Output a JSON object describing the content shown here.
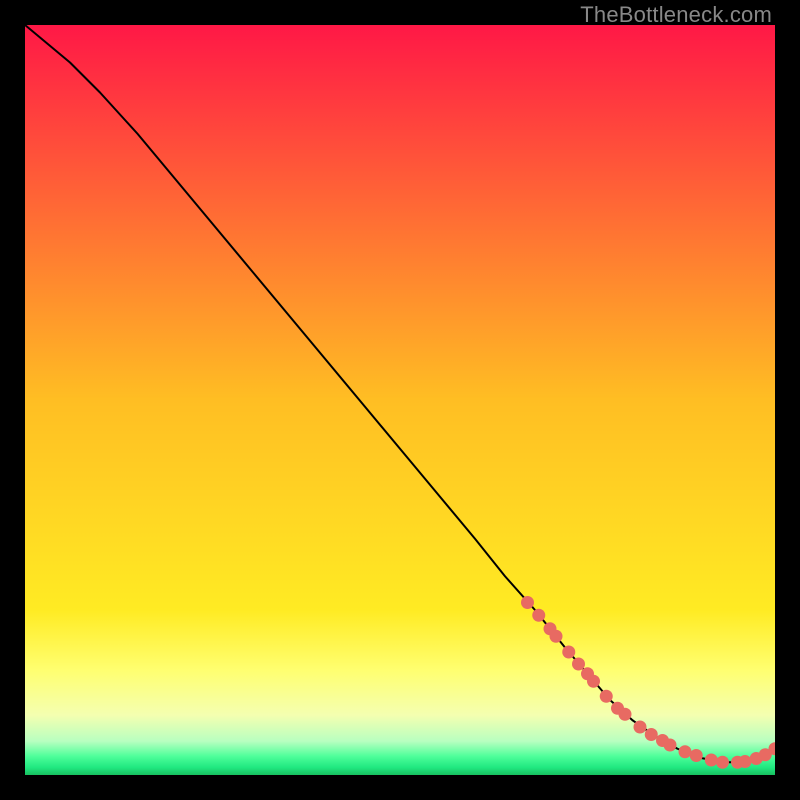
{
  "watermark": "TheBottleneck.com",
  "colors": {
    "background": "#000000",
    "curve": "#000000",
    "marker": "#e86a62",
    "gradient_stops": [
      {
        "offset": 0.0,
        "color": "#ff1846"
      },
      {
        "offset": 0.5,
        "color": "#ffbe23"
      },
      {
        "offset": 0.78,
        "color": "#ffeb23"
      },
      {
        "offset": 0.86,
        "color": "#ffff70"
      },
      {
        "offset": 0.92,
        "color": "#f4ffb0"
      },
      {
        "offset": 0.955,
        "color": "#b8ffc0"
      },
      {
        "offset": 0.975,
        "color": "#4eff9a"
      },
      {
        "offset": 0.99,
        "color": "#20e880"
      },
      {
        "offset": 1.0,
        "color": "#18c060"
      }
    ]
  },
  "chart_data": {
    "type": "line",
    "title": "",
    "xlabel": "",
    "ylabel": "",
    "xlim": [
      0,
      100
    ],
    "ylim": [
      0,
      100
    ],
    "series": [
      {
        "name": "curve",
        "x": [
          0,
          6,
          10,
          15,
          20,
          25,
          30,
          35,
          40,
          45,
          50,
          55,
          60,
          64,
          68,
          72,
          75,
          78,
          81,
          84,
          87,
          90,
          93,
          96,
          99,
          100
        ],
        "y": [
          100,
          95,
          91,
          85.5,
          79.5,
          73.5,
          67.5,
          61.5,
          55.5,
          49.5,
          43.5,
          37.5,
          31.5,
          26.5,
          22,
          17,
          13.5,
          10,
          7.3,
          5.2,
          3.5,
          2.3,
          1.7,
          1.7,
          2.9,
          3.5
        ]
      }
    ],
    "markers": {
      "name": "highlighted region",
      "x": [
        67,
        68.5,
        70,
        70.8,
        72.5,
        73.8,
        75,
        75.8,
        77.5,
        79,
        80,
        82,
        83.5,
        85,
        86,
        88,
        89.5,
        91.5,
        93,
        95,
        96,
        97.5,
        98.7,
        100
      ],
      "y": [
        23.0,
        21.3,
        19.5,
        18.5,
        16.4,
        14.8,
        13.5,
        12.5,
        10.5,
        8.9,
        8.1,
        6.4,
        5.4,
        4.6,
        4.0,
        3.1,
        2.6,
        2.0,
        1.7,
        1.7,
        1.8,
        2.2,
        2.7,
        3.5
      ]
    }
  }
}
